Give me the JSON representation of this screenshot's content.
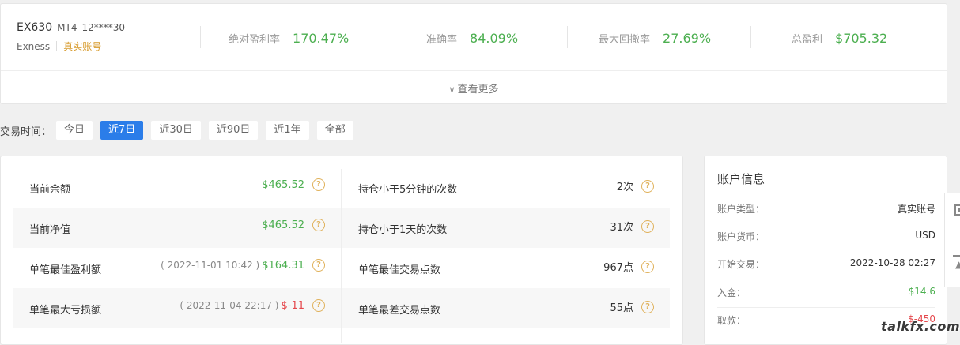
{
  "account": {
    "name": "EX630",
    "platform": "MT4",
    "number": "12****30",
    "broker": "Exness",
    "type": "真实账号"
  },
  "summary": [
    {
      "label": "绝对盈利率",
      "value": "170.47%"
    },
    {
      "label": "准确率",
      "value": "84.09%"
    },
    {
      "label": "最大回撤率",
      "value": "27.69%"
    },
    {
      "label": "总盈利",
      "value": "$705.32"
    }
  ],
  "more_label": "查看更多",
  "filter": {
    "label": "交易时间：",
    "options": [
      "今日",
      "近7日",
      "近30日",
      "近90日",
      "近1年",
      "全部"
    ],
    "selected": "近7日"
  },
  "stats_left": [
    {
      "label": "当前余额",
      "time": "",
      "value": "$465.52",
      "color": "green"
    },
    {
      "label": "当前净值",
      "time": "",
      "value": "$465.52",
      "color": "green"
    },
    {
      "label": "单笔最佳盈利额",
      "time": "( 2022-11-01 10:42 )",
      "value": "$164.31",
      "color": "green"
    },
    {
      "label": "单笔最大亏损额",
      "time": "( 2022-11-04 22:17 )",
      "value": "$-11",
      "color": "red"
    }
  ],
  "stats_right": [
    {
      "label": "持仓小于5分钟的次数",
      "value": "2次"
    },
    {
      "label": "持仓小于1天的次数",
      "value": "31次"
    },
    {
      "label": "单笔最佳交易点数",
      "value": "967点"
    },
    {
      "label": "单笔最差交易点数",
      "value": "55点"
    }
  ],
  "info": {
    "title": "账户信息",
    "rows": [
      {
        "label": "账户类型：",
        "value": "真实账号",
        "color": ""
      },
      {
        "label": "账户货币：",
        "value": "USD",
        "color": ""
      },
      {
        "label": "开始交易：",
        "value": "2022-10-28 02:27",
        "color": ""
      },
      {
        "label": "入金：",
        "value": "$14.6",
        "color": "green"
      },
      {
        "label": "取款：",
        "value": "$-450",
        "color": "red"
      }
    ]
  },
  "help_glyph": "?",
  "watermark": "talkfx.com",
  "colors": {
    "positive": "#4caf50",
    "negative": "#e5484d",
    "accent": "#2b7de9",
    "badge": "#d79a2b"
  }
}
